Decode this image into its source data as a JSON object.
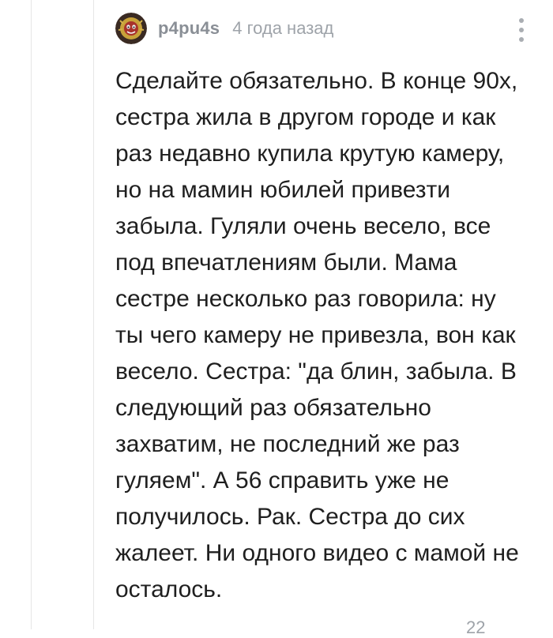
{
  "comment": {
    "username": "p4pu4s",
    "timestamp": "4 года назад",
    "text": "Сделайте обязательно. В конце 90х, сестра жила в другом городе и как раз недавно купила крутую камеру, но на мамин юбилей привезти забыла. Гуляли очень весело, все под впечатлениям были. Мама сестре несколько раз говорила: ну ты чего камеру не привезла, вон как весело. Сестра: \"да блин, забыла. В следующий раз обязательно захватим, не последний же раз гуляем\". А 56 справить уже не получилось. Рак. Сестра до сих жалеет. Ни одного видео с мамой не осталось.",
    "more_icon": "vertical-dots-icon",
    "avatar_icon": "user-avatar"
  },
  "footer": {
    "partial_text": "22"
  },
  "colors": {
    "username": "#8a8f96",
    "timestamp": "#9ea3a9",
    "text": "#1f1f1f",
    "thread_line": "#e6e6e6"
  }
}
